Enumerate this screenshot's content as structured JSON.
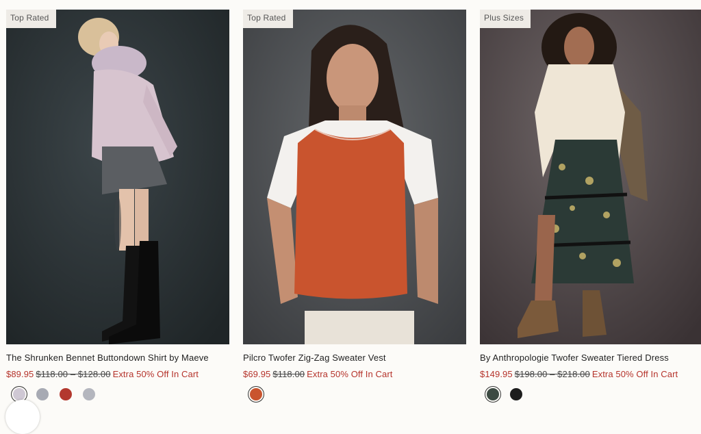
{
  "products": [
    {
      "badge": "Top Rated",
      "title": "The Shrunken Bennet Buttondown Shirt by Maeve",
      "sale_price": "$89.95",
      "original_price": "$118.00 – $128.00",
      "promo": "Extra 50% Off In Cart",
      "swatches": [
        {
          "name": "lilac-print",
          "color": "#cfc8d4",
          "selected": true
        },
        {
          "name": "grey",
          "color": "#a7aab3",
          "selected": false
        },
        {
          "name": "red-bow",
          "color": "#b3382e",
          "selected": false
        },
        {
          "name": "light-grey",
          "color": "#b4b6be",
          "selected": false
        }
      ]
    },
    {
      "badge": "Top Rated",
      "title": "Pilcro Twofer Zig-Zag Sweater Vest",
      "sale_price": "$69.95",
      "original_price": "$118.00",
      "promo": "Extra 50% Off In Cart",
      "swatches": [
        {
          "name": "orange",
          "color": "#c9542e",
          "selected": true
        }
      ]
    },
    {
      "badge": "Plus Sizes",
      "title": "By Anthropologie Twofer Sweater Tiered Dress",
      "sale_price": "$149.95",
      "original_price": "$198.00 – $218.00",
      "promo": "Extra 50% Off In Cart",
      "swatches": [
        {
          "name": "dark-floral",
          "color": "#3c4a42",
          "selected": true
        },
        {
          "name": "black",
          "color": "#1d1d1d",
          "selected": false
        }
      ]
    }
  ],
  "colors": {
    "sale": "#b5332b",
    "badge_bg": "#eeebe6",
    "page_bg": "#fcfbf8"
  }
}
